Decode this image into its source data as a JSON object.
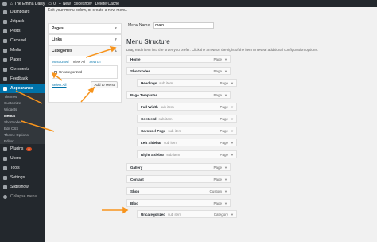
{
  "adminbar": {
    "site_name": "The Emma Daisy",
    "comments": "0",
    "new": "New",
    "slideshow": "Slideshow",
    "delete_cache": "Delete Cache"
  },
  "sidebar": {
    "items": [
      {
        "label": "Dashboard"
      },
      {
        "label": "Jetpack"
      },
      {
        "label": "Posts"
      },
      {
        "label": "Carousel"
      },
      {
        "label": "Media"
      },
      {
        "label": "Pages"
      },
      {
        "label": "Comments"
      },
      {
        "label": "Feedback"
      },
      {
        "label": "Appearance"
      },
      {
        "label": "Plugins",
        "badge": "8"
      },
      {
        "label": "Users"
      },
      {
        "label": "Tools"
      },
      {
        "label": "Settings"
      },
      {
        "label": "Slideshow"
      },
      {
        "label": "Collapse menu"
      }
    ],
    "appearance_sub": [
      "Themes",
      "Customize",
      "Widgets",
      "Menus",
      "Shortcodes",
      "Edit CSS",
      "Theme Options",
      "Editor"
    ]
  },
  "main": {
    "notice": "Edit your menu below, or create a new menu.",
    "accordion": {
      "pages": "Pages",
      "links": "Links",
      "categories": "Categories",
      "tabs": [
        "Most Used",
        "View All",
        "Search"
      ],
      "category_item": "Uncategorized",
      "select_all": "Select All",
      "add_to_menu": "Add to Menu"
    },
    "menu_name_label": "Menu Name",
    "menu_name_value": "main",
    "menu_structure_title": "Menu Structure",
    "menu_structure_help": "Drag each item into the order you prefer. Click the arrow on the right of the item to reveal additional configuration options.",
    "sub_item_label": "sub item",
    "items": [
      {
        "title": "Home",
        "type": "Page",
        "sub": false
      },
      {
        "title": "Shortcodes",
        "type": "Page",
        "sub": false
      },
      {
        "title": "Headings",
        "type": "Page",
        "sub": true
      },
      {
        "title": "Page Templates",
        "type": "Page",
        "sub": false
      },
      {
        "title": "Full Width",
        "type": "Page",
        "sub": true
      },
      {
        "title": "Centered",
        "type": "Page",
        "sub": true
      },
      {
        "title": "Carousel Page",
        "type": "Page",
        "sub": true
      },
      {
        "title": "Left Sidebar",
        "type": "Page",
        "sub": true
      },
      {
        "title": "Right Sidebar",
        "type": "Page",
        "sub": true
      },
      {
        "title": "Gallery",
        "type": "Page",
        "sub": false
      },
      {
        "title": "Contact",
        "type": "Page",
        "sub": false
      },
      {
        "title": "Shop",
        "type": "Custom",
        "sub": false
      },
      {
        "title": "Blog",
        "type": "Page",
        "sub": false
      },
      {
        "title": "Uncategorized",
        "type": "Category",
        "sub": true
      }
    ]
  },
  "colors": {
    "admin_dark": "#23282d",
    "active_blue": "#0073aa",
    "annotation_orange": "#f7941d"
  },
  "icons": {
    "wp_logo": "wordpress-logo-icon",
    "comment": "comment-bubble-icon",
    "plus": "plus-icon",
    "menu_caret": "caret-down-icon"
  }
}
